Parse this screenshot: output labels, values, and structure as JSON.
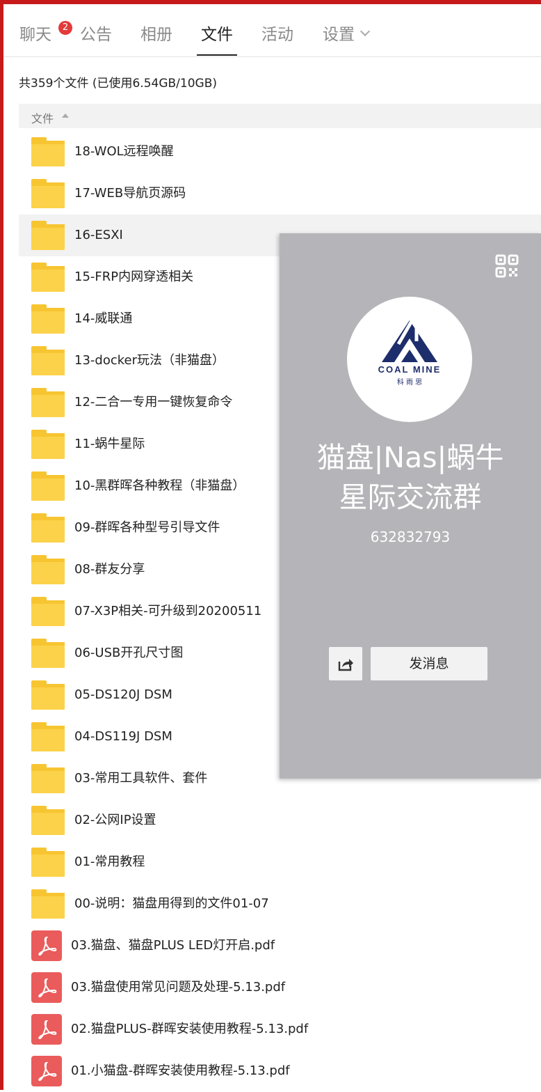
{
  "tabs": [
    {
      "label": "聊天",
      "badge": "2"
    },
    {
      "label": "公告"
    },
    {
      "label": "相册"
    },
    {
      "label": "文件"
    },
    {
      "label": "活动"
    },
    {
      "label": "设置"
    }
  ],
  "active_tab": "文件",
  "summary": "共359个文件 (已使用6.54GB/10GB)",
  "column_header": "文件",
  "folders": [
    "18-WOL远程唤醒",
    "17-WEB导航页源码",
    "16-ESXI",
    "15-FRP内网穿透相关",
    "14-威联通",
    "13-docker玩法（非猫盘）",
    "12-二合一专用一键恢复命令",
    "11-蜗牛星际",
    "10-黑群晖各种教程（非猫盘）",
    "09-群晖各种型号引导文件",
    "08-群友分享",
    "07-X3P相关-可升级到20200511",
    "06-USB开孔尺寸图",
    "05-DS120J DSM",
    "04-DS119J DSM",
    "03-常用工具软件、套件",
    "02-公网IP设置",
    "01-常用教程",
    "00-说明：猫盘用得到的文件01-07"
  ],
  "files": [
    "03.猫盘、猫盘PLUS LED灯开启.pdf",
    "03.猫盘使用常见问题及处理-5.13.pdf",
    "02.猫盘PLUS-群晖安装使用教程-5.13.pdf",
    "01.小猫盘-群晖安装使用教程-5.13.pdf"
  ],
  "group_card": {
    "logo_text": "COAL MINE",
    "logo_subtext": "科 雨 思",
    "name_line1": "猫盘|Nas|蜗牛",
    "name_line2": "星际交流群",
    "id": "632832793",
    "send_message_label": "发消息",
    "share_icon": "share-icon",
    "qr_icon": "qr-code-icon"
  },
  "colors": {
    "frame": "#c71a1a",
    "badge": "#e23b3b",
    "folder": "#fbd249",
    "pdf": "#ea5b5b",
    "card_bg": "#b5b4b8",
    "logo_navy": "#1e2d6b"
  }
}
